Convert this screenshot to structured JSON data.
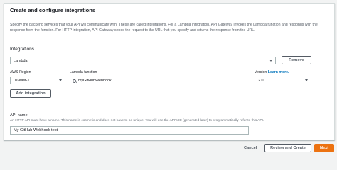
{
  "panel": {
    "title": "Create and configure integrations",
    "description": "Specify the backend services that your API will communicate with. These are called integrations. For a Lambda integration, API Gateway invokes the Lambda function and responds with the response from the function. For HTTP integration, API Gateway sends the request to the URL that you specify and returns the response from the URL."
  },
  "integrations": {
    "label": "Integrations",
    "type_value": "Lambda",
    "remove_label": "Remove",
    "region_label": "AWS Region",
    "region_value": "us-east-1",
    "function_label": "Lambda function",
    "function_value": "myGitHubWebhook",
    "version_label": "Version",
    "version_link": "Learn more.",
    "version_value": "2.0",
    "add_label": "Add integration"
  },
  "api": {
    "name_label": "API name",
    "name_hint": "An HTTP API must have a name. This name is cosmetic and does not have to be unique. You will use the API's ID (generated later) to programmatically refer to this API.",
    "name_value": "My GitHub Webhook test"
  },
  "footer": {
    "cancel_label": "Cancel",
    "review_label": "Review and Create",
    "next_label": "Next"
  }
}
